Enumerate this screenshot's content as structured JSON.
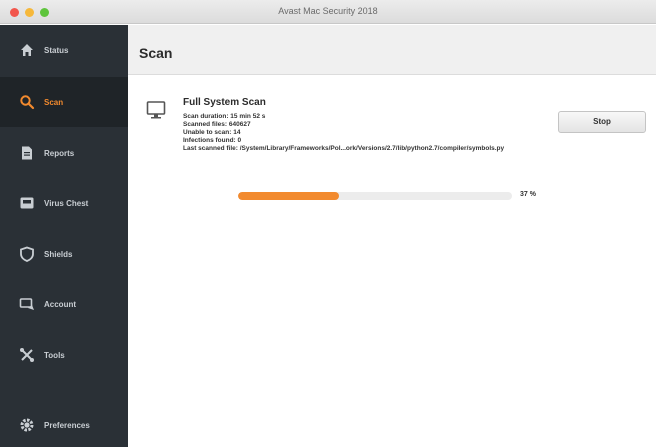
{
  "window": {
    "title": "Avast Mac Security 2018"
  },
  "sidebar": {
    "items": [
      {
        "label": "Status",
        "icon": "home-icon"
      },
      {
        "label": "Scan",
        "icon": "search-icon",
        "active": true
      },
      {
        "label": "Reports",
        "icon": "document-icon"
      },
      {
        "label": "Virus Chest",
        "icon": "chest-icon"
      },
      {
        "label": "Shields",
        "icon": "shield-icon"
      },
      {
        "label": "Account",
        "icon": "account-icon"
      },
      {
        "label": "Tools",
        "icon": "tools-icon"
      },
      {
        "label": "Preferences",
        "icon": "gear-icon"
      }
    ]
  },
  "main": {
    "title": "Scan",
    "scan": {
      "title": "Full System Scan",
      "duration": "Scan duration: 15 min 52 s",
      "scanned": "Scanned files: 640627",
      "unable": "Unable to scan: 14",
      "infections": "Infections found: 0",
      "last_file": "Last scanned file: /System/Library/Frameworks/Pol...ork/Versions/2.7/lib/python2.7/compiler/symbols.py",
      "stop_label": "Stop",
      "progress": 0.37,
      "progress_text": "37 %"
    }
  },
  "colors": {
    "accent": "#f28a2e",
    "sidebar": "#2a3036"
  }
}
